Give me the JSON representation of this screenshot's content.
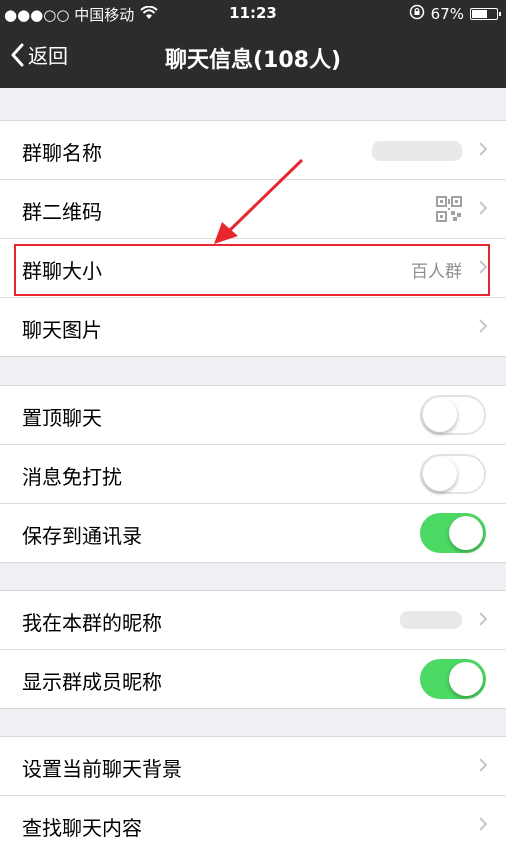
{
  "status_bar": {
    "carrier": "●●●○○ 中国移动",
    "time": "11:23",
    "battery": "67%",
    "battery_level": 0.67
  },
  "nav": {
    "back_label": "返回",
    "title": "聊天信息(108人)"
  },
  "section1": {
    "group_name_label": "群聊名称",
    "qr_code_label": "群二维码",
    "group_size_label": "群聊大小",
    "group_size_value": "百人群",
    "chat_images_label": "聊天图片"
  },
  "section2": {
    "pin_chat_label": "置顶聊天",
    "pin_chat_on": false,
    "mute_label": "消息免打扰",
    "mute_on": false,
    "save_contacts_label": "保存到通讯录",
    "save_contacts_on": true
  },
  "section3": {
    "my_nickname_label": "我在本群的昵称",
    "show_nicknames_label": "显示群成员昵称",
    "show_nicknames_on": true
  },
  "section4": {
    "background_label": "设置当前聊天背景",
    "search_label": "查找聊天内容"
  },
  "colors": {
    "nav_bg": "#2c2c2e",
    "switch_on": "#4cd964",
    "highlight": "#e8262d"
  }
}
